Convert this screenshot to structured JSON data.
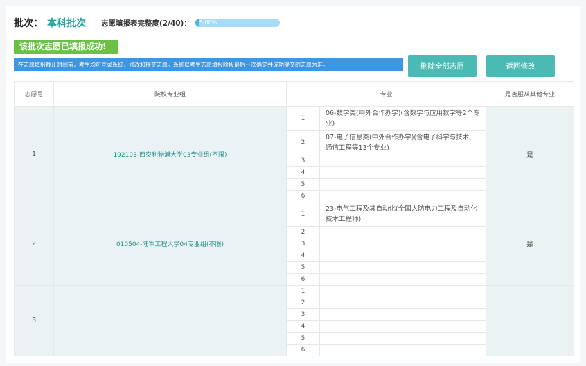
{
  "header": {
    "batch_label": "批次：",
    "batch_value": "本科批次",
    "progress_label": "志愿填报表完整度(2/40)：",
    "progress_text": "5.00%",
    "progress_fraction": 0.05
  },
  "success_message": "该批次志愿已填报成功!",
  "notice": "在志愿填报截止时间前，考生均可登录系统，修改和提交志愿。系统以考生志愿填报阶段最后一次确定并成功提交的志愿为准。",
  "buttons": {
    "delete_all": "删除全部志愿",
    "back_edit": "返回修改"
  },
  "table": {
    "headers": {
      "index": "志愿号",
      "school": "院校专业组",
      "major": "专业",
      "obey": "是否服从其他专业"
    },
    "groups": [
      {
        "index": "1",
        "school": "192103-西交利物浦大学03专业组(不限)",
        "obey": "是",
        "majors": [
          {
            "no": "1",
            "name": "06-数学类(中外合作办学)(含数学与应用数学等2个专 业)"
          },
          {
            "no": "2",
            "name": "07-电子信息类(中外合作办学)(含电子科学与技术、通信工程等13个专业)"
          },
          {
            "no": "3",
            "name": ""
          },
          {
            "no": "4",
            "name": ""
          },
          {
            "no": "5",
            "name": ""
          },
          {
            "no": "6",
            "name": ""
          }
        ]
      },
      {
        "index": "2",
        "school": "010504-陆军工程大学04专业组(不限)",
        "obey": "是",
        "majors": [
          {
            "no": "1",
            "name": "23-电气工程及其自动化(全国人防电力工程及自动化技术工程师)"
          },
          {
            "no": "2",
            "name": ""
          },
          {
            "no": "3",
            "name": ""
          },
          {
            "no": "4",
            "name": ""
          },
          {
            "no": "5",
            "name": ""
          },
          {
            "no": "6",
            "name": ""
          }
        ]
      },
      {
        "index": "3",
        "school": "",
        "obey": "",
        "majors": [
          {
            "no": "1",
            "name": ""
          },
          {
            "no": "2",
            "name": ""
          },
          {
            "no": "3",
            "name": ""
          },
          {
            "no": "4",
            "name": ""
          },
          {
            "no": "5",
            "name": ""
          },
          {
            "no": "6",
            "name": ""
          }
        ]
      }
    ]
  }
}
